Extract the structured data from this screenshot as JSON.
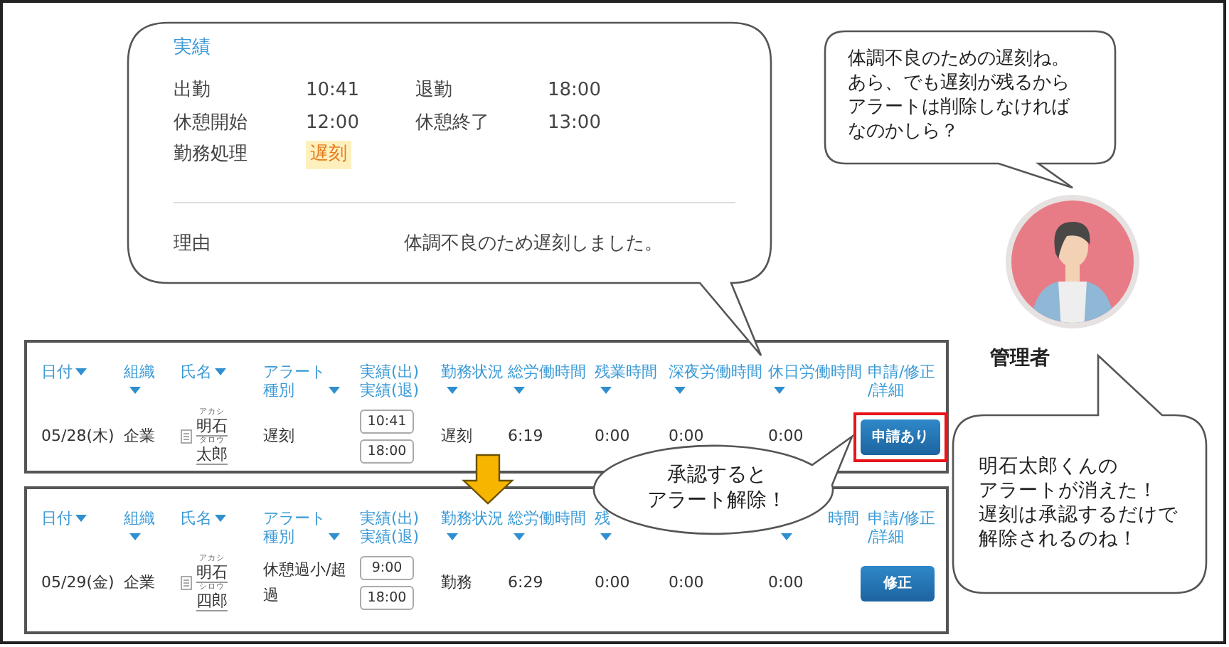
{
  "detail_callout": {
    "title": "実績",
    "fields": [
      {
        "label": "出勤",
        "value": "10:41"
      },
      {
        "label": "退勤",
        "value": "18:00"
      },
      {
        "label": "休憩開始",
        "value": "12:00"
      },
      {
        "label": "休憩終了",
        "value": "13:00"
      },
      {
        "label": "勤務処理",
        "value": "遅刻",
        "kind": "tag"
      }
    ],
    "reason_label": "理由",
    "reason": "体調不良のため遅刻しました。"
  },
  "manager_comment_before": {
    "lines": [
      "体調不良のための遅刻ね。",
      "あら、でも遅刻が残るから",
      "アラートは削除しなければ",
      "なのかしら？"
    ]
  },
  "manager": {
    "label": "管理者"
  },
  "tables": [
    {
      "highlighted": true,
      "headers": [
        {
          "lines": [
            "日付"
          ],
          "kind": "inline"
        },
        {
          "lines": [
            "組織"
          ],
          "kind": "below"
        },
        {
          "lines": [
            "氏名"
          ],
          "kind": "inline"
        },
        {
          "lines": [
            "アラート",
            "種別"
          ],
          "kind": "inline"
        },
        {
          "lines": [
            "実績(出)",
            "実績(退)"
          ],
          "kind": "plain"
        },
        {
          "lines": [
            "勤務状況"
          ],
          "kind": "below"
        },
        {
          "lines": [
            "総労働時間"
          ],
          "kind": "below"
        },
        {
          "lines": [
            "残業時間"
          ],
          "kind": "below"
        },
        {
          "lines": [
            "深夜労働時間"
          ],
          "kind": "below"
        },
        {
          "lines": [
            "休日労働時間"
          ],
          "kind": "below"
        },
        {
          "lines": [
            "申請/修正",
            "/詳細"
          ],
          "kind": "plain"
        }
      ],
      "row": {
        "date": "05/28(木)",
        "org": "企業",
        "name": {
          "family_kana": "アカシ",
          "family": "明石",
          "given_kana": "タロウ",
          "given": "太郎"
        },
        "alert": "遅刻",
        "clock_in": "10:41",
        "clock_out": "18:00",
        "status": "遅刻",
        "total": "6:19",
        "overtime": "0:00",
        "night": "0:00",
        "holiday": "0:00",
        "action": "申請あり"
      }
    },
    {
      "highlighted": false,
      "headers": [
        {
          "lines": [
            "日付"
          ],
          "kind": "inline"
        },
        {
          "lines": [
            "組織"
          ],
          "kind": "below"
        },
        {
          "lines": [
            "氏名"
          ],
          "kind": "inline"
        },
        {
          "lines": [
            "アラート",
            "種別"
          ],
          "kind": "inline"
        },
        {
          "lines": [
            "実績(出)",
            "実績(退)"
          ],
          "kind": "plain"
        },
        {
          "lines": [
            "勤務状況"
          ],
          "kind": "below"
        },
        {
          "lines": [
            "総労働時間"
          ],
          "kind": "below"
        },
        {
          "lines": [
            "残"
          ],
          "kind": "below"
        },
        {
          "lines": [
            "時間"
          ],
          "kind": "below",
          "cut": true
        },
        {
          "lines": [
            "申請/修正",
            "/詳細"
          ],
          "kind": "plain"
        }
      ],
      "row": {
        "date": "05/29(金)",
        "org": "企業",
        "name": {
          "family_kana": "アカシ",
          "family": "明石",
          "given_kana": "シロウ",
          "given": "四郎"
        },
        "alert": "休憩過小/超過",
        "clock_in": "9:00",
        "clock_out": "18:00",
        "status": "勤務",
        "total": "6:29",
        "overtime": "0:00",
        "night": "0:00",
        "holiday": "0:00",
        "action": "修正"
      }
    }
  ],
  "approve_callout": {
    "lines": [
      "承認すると",
      "アラート解除！"
    ]
  },
  "manager_comment_after": {
    "lines": [
      "明石太郎くんの",
      "アラートが消えた！",
      "遅刻は承認するだけで",
      "解除されるのね！"
    ]
  }
}
